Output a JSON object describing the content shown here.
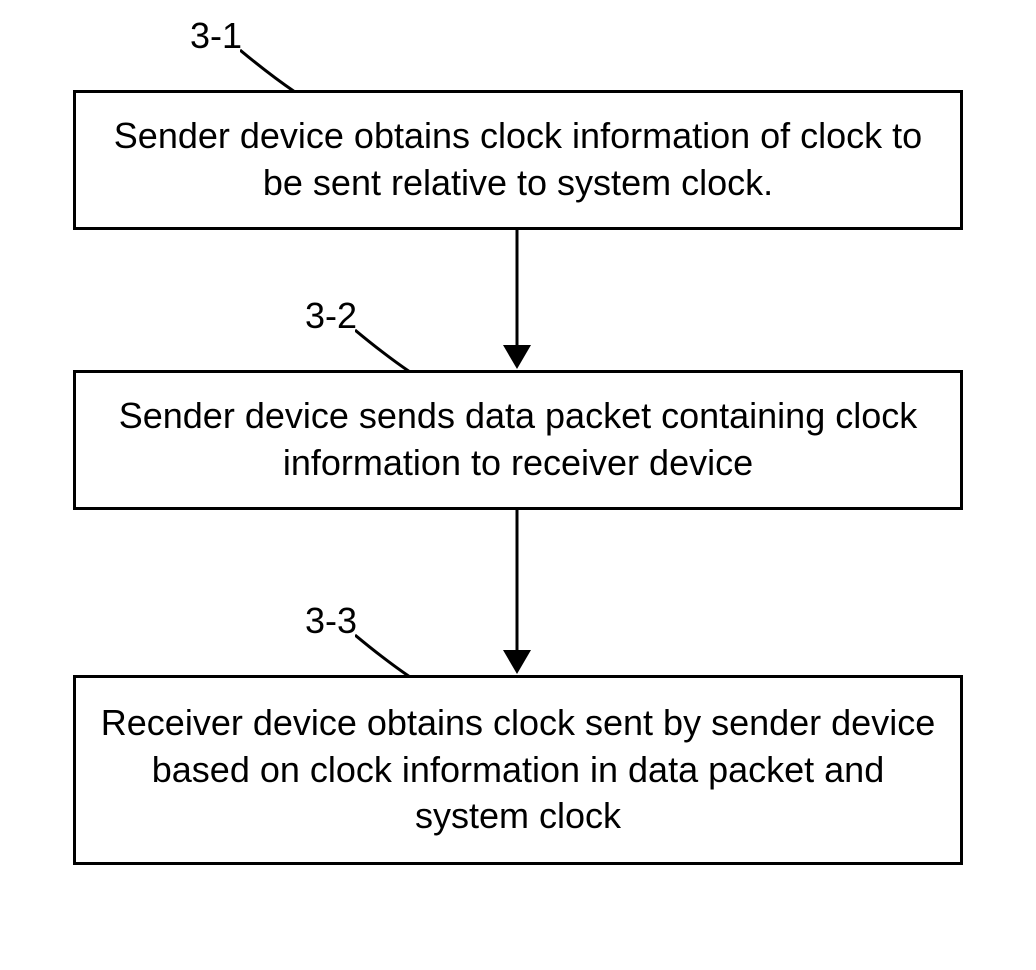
{
  "diagram": {
    "steps": [
      {
        "label": "3-1",
        "text": "Sender device obtains clock information of clock to be sent relative to system clock."
      },
      {
        "label": "3-2",
        "text": "Sender device sends data packet containing clock information to receiver device"
      },
      {
        "label": "3-3",
        "text": "Receiver device obtains clock sent by sender device based on clock information in data packet and system clock"
      }
    ]
  }
}
